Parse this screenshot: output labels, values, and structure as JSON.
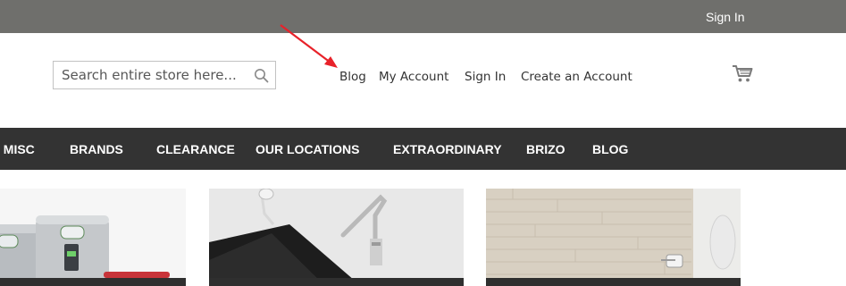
{
  "top_bar": {
    "sign_in": "Sign In"
  },
  "search": {
    "placeholder": "Search entire store here..."
  },
  "header_links": {
    "blog": "Blog",
    "my_account": "My Account",
    "sign_in": "Sign In",
    "create_account": "Create an Account"
  },
  "nav": {
    "items": [
      {
        "label": ", MISC"
      },
      {
        "label": "BRANDS"
      },
      {
        "label": "CLEARANCE"
      },
      {
        "label": "OUR LOCATIONS"
      },
      {
        "label": "EXTRAORDINARY"
      },
      {
        "label": "BRIZO"
      },
      {
        "label": "BLOG"
      }
    ]
  },
  "icons": {
    "search": "search-icon",
    "cart": "cart-icon"
  },
  "colors": {
    "top_bar": "#6f6f6c",
    "nav_bar": "#333333",
    "annotation_arrow": "#e8222a",
    "link_text": "#333333"
  }
}
